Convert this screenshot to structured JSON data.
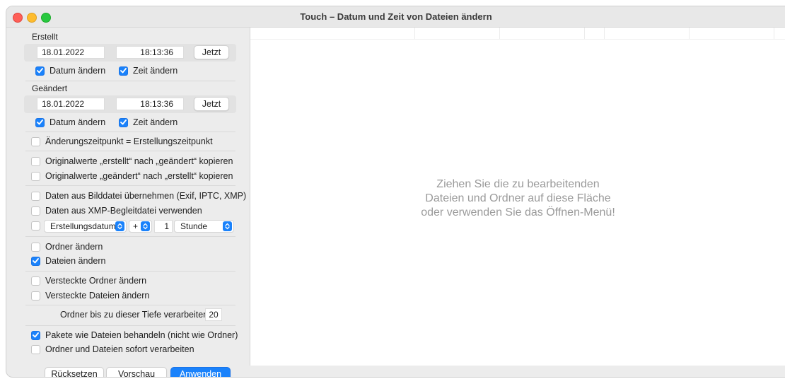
{
  "window": {
    "title": "Touch – Datum und Zeit von Dateien ändern"
  },
  "created": {
    "label": "Erstellt",
    "date": "18.01.2022",
    "time": "18:13:36",
    "now_button": "Jetzt",
    "change_date": {
      "label": "Datum ändern",
      "checked": true
    },
    "change_time": {
      "label": "Zeit ändern",
      "checked": true
    }
  },
  "modified": {
    "label": "Geändert",
    "date": "18.01.2022",
    "time": "18:13:36",
    "now_button": "Jetzt",
    "change_date": {
      "label": "Datum ändern",
      "checked": true
    },
    "change_time": {
      "label": "Zeit ändern",
      "checked": true
    }
  },
  "options": {
    "modtime_equals_created": {
      "label": "Änderungszeitpunkt = Erstellungszeitpunkt",
      "checked": false
    },
    "copy_created_to_modified": {
      "label": "Originalwerte „erstellt“ nach „geändert“ kopieren",
      "checked": false
    },
    "copy_modified_to_created": {
      "label": "Originalwerte „geändert“ nach „erstellt“ kopieren",
      "checked": false
    },
    "from_image": {
      "label": "Daten aus Bilddatei übernehmen (Exif, IPTC, XMP)",
      "checked": false
    },
    "from_xmp": {
      "label": "Daten aus XMP-Begleitdatei verwenden",
      "checked": false
    },
    "offset": {
      "checked": false,
      "field": "Erstellungsdatum",
      "sign": "+",
      "amount": "1",
      "unit": "Stunde"
    },
    "change_folders": {
      "label": "Ordner ändern",
      "checked": false
    },
    "change_files": {
      "label": "Dateien ändern",
      "checked": true
    },
    "hidden_folders": {
      "label": "Versteckte Ordner ändern",
      "checked": false
    },
    "hidden_files": {
      "label": "Versteckte Dateien ändern",
      "checked": false
    },
    "depth": {
      "label": "Ordner bis zu dieser Tiefe verarbeiten:",
      "value": "20"
    },
    "packages_as_files": {
      "label": "Pakete wie Dateien behandeln (nicht wie Ordner)",
      "checked": true
    },
    "process_immediately": {
      "label": "Ordner und Dateien sofort verarbeiten",
      "checked": false
    }
  },
  "buttons": {
    "reset": "Rücksetzen",
    "preview": "Vorschau",
    "apply": "Anwenden"
  },
  "dropzone": {
    "line1": "Ziehen Sie die zu bearbeitenden",
    "line2": "Dateien und Ordner auf diese Fläche",
    "line3": "oder verwenden Sie das Öffnen-Menü!"
  },
  "colors": {
    "accent": "#1a82fb",
    "close": "#fe5f57",
    "minimize": "#febc2e",
    "zoom": "#28c840"
  }
}
